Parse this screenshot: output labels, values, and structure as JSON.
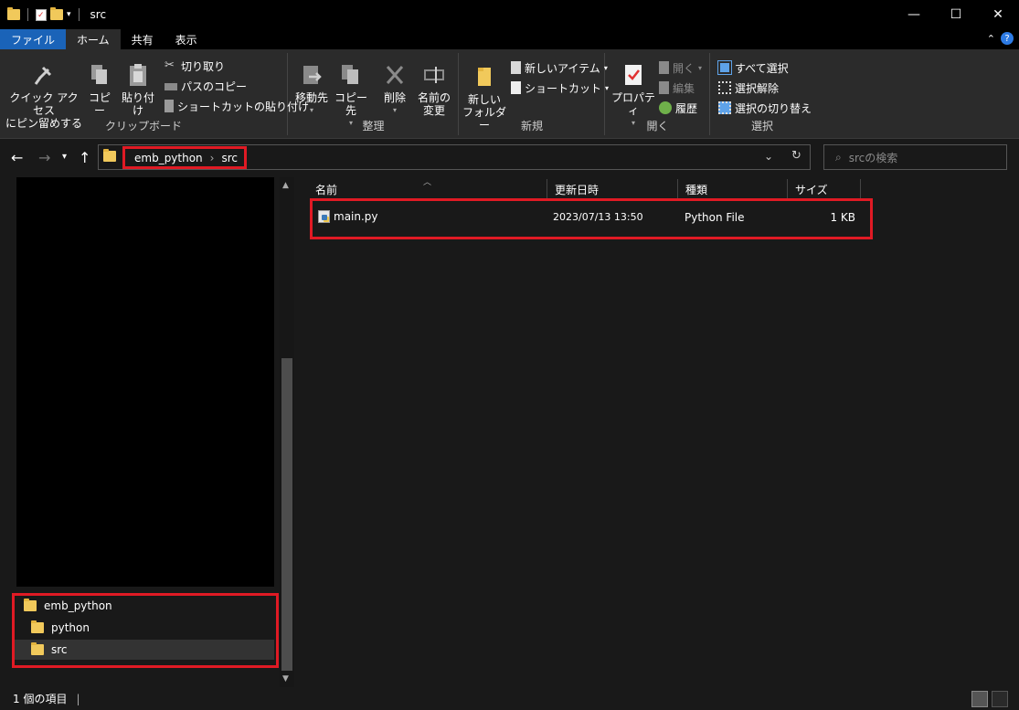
{
  "window": {
    "title": "src",
    "controls": [
      "—",
      "☐",
      "✕"
    ]
  },
  "ribbon_tabs": [
    {
      "label": "ファイル"
    },
    {
      "label": "ホーム"
    },
    {
      "label": "共有"
    },
    {
      "label": "表示"
    }
  ],
  "ribbon": {
    "clipboard": {
      "label": "クリップボード",
      "pin_line1": "クイック アクセス",
      "pin_line2": "にピン留めする",
      "copy": "コピー",
      "paste": "貼り付け",
      "cut": "切り取り",
      "copy_path": "パスのコピー",
      "paste_shortcut": "ショートカットの貼り付け"
    },
    "organize": {
      "label": "整理",
      "move_to": "移動先",
      "copy_to": "コピー先",
      "delete": "削除",
      "rename_line1": "名前の",
      "rename_line2": "変更"
    },
    "new": {
      "label": "新規",
      "new_folder_line1": "新しい",
      "new_folder_line2": "フォルダー",
      "new_item": "新しいアイテム",
      "shortcut": "ショートカット"
    },
    "open": {
      "label": "開く",
      "properties": "プロパティ",
      "open": "開く",
      "edit": "編集",
      "history": "履歴"
    },
    "select": {
      "label": "選択",
      "select_all": "すべて選択",
      "select_none": "選択解除",
      "invert": "選択の切り替え"
    }
  },
  "address": {
    "crumbs": [
      "emb_python",
      "src"
    ],
    "separator": "›",
    "search_placeholder": "srcの検索"
  },
  "nav_tree": [
    {
      "label": "emb_python"
    },
    {
      "label": "python"
    },
    {
      "label": "src"
    }
  ],
  "columns": [
    {
      "label": "名前"
    },
    {
      "label": "更新日時"
    },
    {
      "label": "種類"
    },
    {
      "label": "サイズ"
    }
  ],
  "files": [
    {
      "name": "main.py",
      "modified": "2023/07/13 13:50",
      "type": "Python File",
      "size": "1 KB"
    }
  ],
  "status": {
    "count": "1 個の項目"
  }
}
